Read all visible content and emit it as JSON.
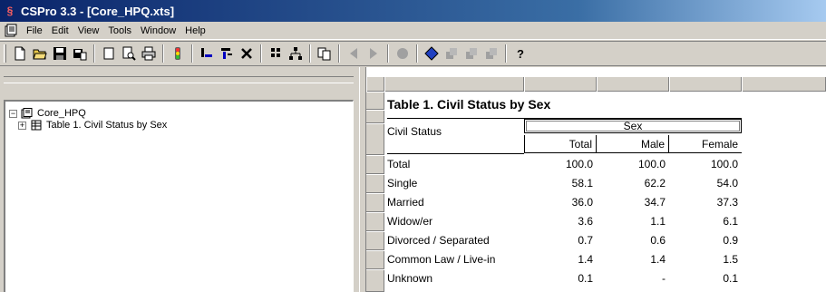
{
  "window": {
    "title": "CSPro 3.3 - [Core_HPQ.xts]",
    "app_icon": "cspro-app-icon"
  },
  "menu": {
    "items": [
      "File",
      "Edit",
      "View",
      "Tools",
      "Window",
      "Help"
    ]
  },
  "toolbar": {
    "buttons": [
      "new-icon",
      "open-icon",
      "save-icon",
      "save-as-icon",
      "page-icon",
      "print-preview-icon",
      "print-icon",
      "run-icon",
      "add-row-icon",
      "add-column-icon",
      "delete-icon",
      "grid-icon",
      "tree-icon",
      "copy-icon",
      "back-icon",
      "forward-icon",
      "record-icon",
      "diamond-icon",
      "stack-1-icon",
      "stack-2-icon",
      "stack-3-icon",
      "help-icon"
    ]
  },
  "tree": {
    "root": {
      "label": "Core_HPQ",
      "expander": "−"
    },
    "child": {
      "label": "Table 1. Civil Status by Sex",
      "expander": "+"
    }
  },
  "table": {
    "title": "Table 1. Civil Status by Sex",
    "stub_head": "Civil Status",
    "spanner": "Sex",
    "columns": [
      "Total",
      "Male",
      "Female"
    ],
    "rows": [
      {
        "label": "Total",
        "values": [
          "100.0",
          "100.0",
          "100.0"
        ]
      },
      {
        "label": "Single",
        "values": [
          "58.1",
          "62.2",
          "54.0"
        ]
      },
      {
        "label": "Married",
        "values": [
          "36.0",
          "34.7",
          "37.3"
        ]
      },
      {
        "label": "Widow/er",
        "values": [
          "3.6",
          "1.1",
          "6.1"
        ]
      },
      {
        "label": "Divorced / Separated",
        "values": [
          "0.7",
          "0.6",
          "0.9"
        ]
      },
      {
        "label": "Common Law / Live-in",
        "values": [
          "1.4",
          "1.4",
          "1.5"
        ]
      },
      {
        "label": "Unknown",
        "values": [
          "0.1",
          "-",
          "0.1"
        ]
      }
    ]
  },
  "colors": {
    "title_bar_start": "#0a246a",
    "title_bar_end": "#a6caf0",
    "chrome": "#d4d0c8"
  }
}
